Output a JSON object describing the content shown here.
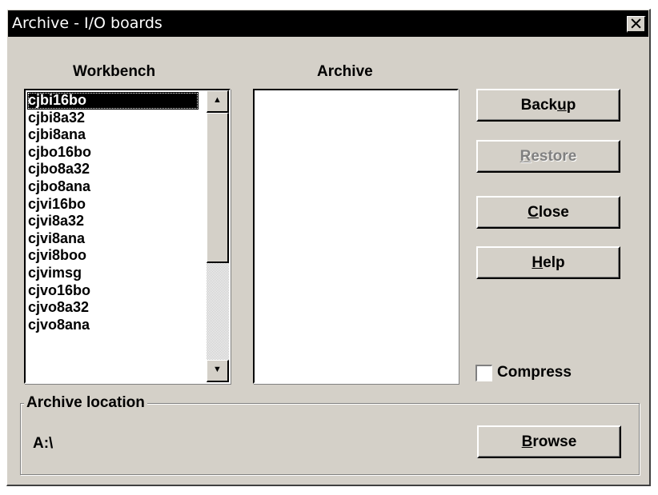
{
  "window": {
    "title": "Archive - I/O boards",
    "close_glyph": "✕"
  },
  "columns": {
    "workbench_label": "Workbench",
    "archive_label": "Archive"
  },
  "workbench_list": {
    "selected_index": 0,
    "items": [
      "cjbi16bo",
      "cjbi8a32",
      "cjbi8ana",
      "cjbo16bo",
      "cjbo8a32",
      "cjbo8ana",
      "cjvi16bo",
      "cjvi8a32",
      "cjvi8ana",
      "cjvi8boo",
      "cjvimsg",
      "cjvo16bo",
      "cjvo8a32",
      "cjvo8ana"
    ]
  },
  "archive_list": {
    "items": []
  },
  "buttons": {
    "backup": {
      "pre": "Back",
      "mnemonic": "u",
      "post": "p"
    },
    "restore": {
      "pre": "",
      "mnemonic": "R",
      "post": "estore",
      "enabled": false
    },
    "close": {
      "pre": "",
      "mnemonic": "C",
      "post": "lose"
    },
    "help": {
      "pre": "",
      "mnemonic": "H",
      "post": "elp"
    },
    "browse": {
      "pre": "",
      "mnemonic": "B",
      "post": "rowse"
    }
  },
  "compress": {
    "label": "Compress",
    "checked": false
  },
  "archive_location": {
    "group_label": "Archive location",
    "path": "A:\\"
  },
  "icons": {
    "scroll_up": "scroll-up-arrow-icon",
    "scroll_down": "scroll-down-arrow-icon",
    "close": "close-x-icon"
  },
  "colors": {
    "face": "#d4d0c8",
    "titlebar": "#000000",
    "selection": "#000000"
  }
}
